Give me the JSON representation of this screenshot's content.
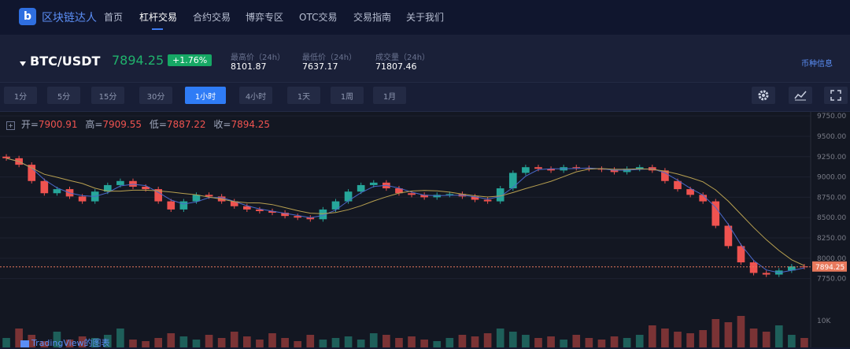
{
  "nav": {
    "brand": "区块链达人",
    "items": [
      "首页",
      "杠杆交易",
      "合约交易",
      "博弈专区",
      "OTC交易",
      "交易指南",
      "关于我们"
    ],
    "active_index": 1
  },
  "ticker": {
    "pair": "BTC/USDT",
    "price": "7894.25",
    "change": "+1.76%",
    "stats": [
      {
        "label": "最高价（24h）",
        "value": "8101.87"
      },
      {
        "label": "最低价（24h）",
        "value": "7637.17"
      },
      {
        "label": "成交量（24h）",
        "value": "71807.46"
      }
    ],
    "info_link": "币种信息"
  },
  "toolbar": {
    "timeframes": [
      "1分",
      "5分",
      "15分",
      "30分",
      "1小时",
      "4小时",
      "1天",
      "1周",
      "1月"
    ],
    "active_index": 4,
    "tools": [
      "gear-icon",
      "indicator-icon",
      "fullscreen-icon"
    ]
  },
  "legend": {
    "open_label": "开=",
    "open": "7900.91",
    "high_label": "高=",
    "high": "7909.55",
    "low_label": "低=",
    "low": "7887.22",
    "close_label": "收=",
    "close": "7894.25"
  },
  "chart_data": {
    "type": "line",
    "series": [
      {
        "values": [
          9230,
          9150,
          8950,
          8800,
          8850,
          8760,
          8700,
          8820,
          8900,
          8950,
          8880,
          8850,
          8700,
          8600,
          8700,
          8780,
          8760,
          8700,
          8640,
          8600,
          8580,
          8560,
          8520,
          8500,
          8480,
          8600,
          8700,
          8820,
          8900,
          8930,
          8860,
          8800,
          8780,
          8750,
          8780,
          8790,
          8760,
          8720,
          8700,
          8860,
          9050,
          9120,
          9100,
          9080,
          9120,
          9110,
          9100,
          9090,
          9060,
          9100,
          9120,
          9080,
          8950,
          8850,
          8780,
          8700,
          8400,
          8150,
          7950,
          7820,
          7800,
          7850,
          7900,
          7894
        ]
      }
    ],
    "y_ticks": [
      "9750.00",
      "9500.00",
      "9250.00",
      "9000.00",
      "8750.00",
      "8500.00",
      "8250.00",
      "8000.00",
      "7750.00"
    ],
    "ylim": [
      7650,
      9800
    ],
    "current_price_label": "7894.25",
    "volume_tick": "10K",
    "volume_values": [
      6,
      12,
      8,
      4,
      10,
      5,
      7,
      6,
      8,
      12,
      5,
      4,
      6,
      9,
      7,
      5,
      8,
      6,
      10,
      7,
      5,
      9,
      6,
      4,
      8,
      5,
      6,
      7,
      5,
      9,
      8,
      6,
      7,
      5,
      4,
      6,
      8,
      7,
      9,
      12,
      10,
      8,
      6,
      7,
      5,
      8,
      6,
      5,
      7,
      6,
      8,
      14,
      12,
      10,
      9,
      11,
      18,
      16,
      20,
      12,
      10,
      14,
      8,
      6
    ]
  },
  "watermark": "TradingView的图表"
}
